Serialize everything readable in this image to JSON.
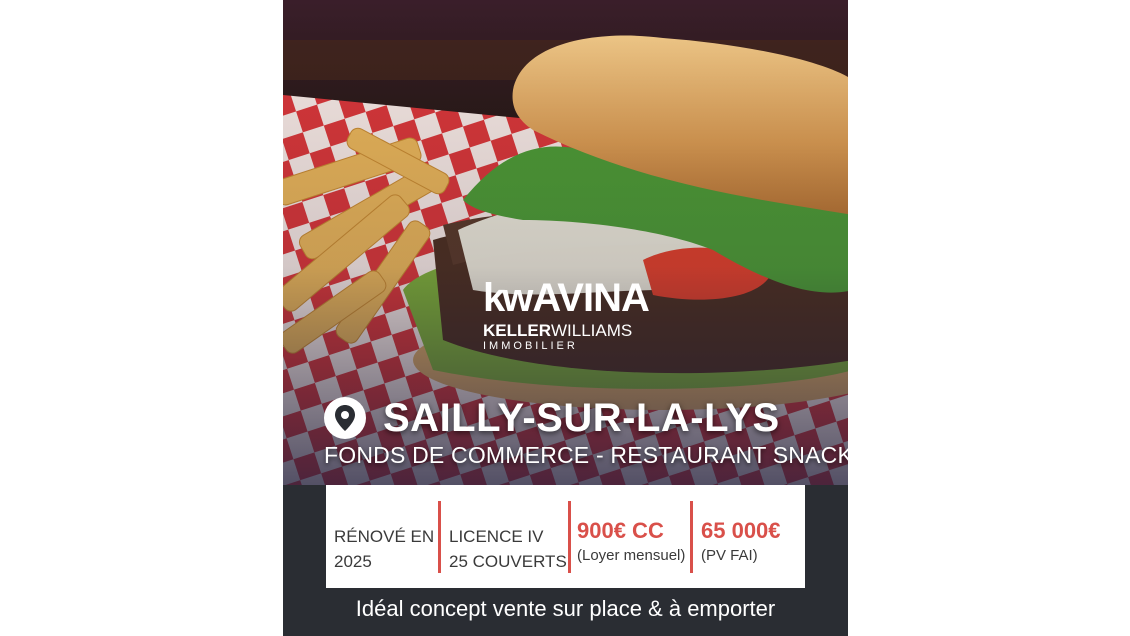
{
  "logo": {
    "kw": "kw",
    "brand": "AVINA",
    "sub_bold": "KELLER",
    "sub_thin": "WILLIAMS",
    "tagline": "IMMOBILIER"
  },
  "location": {
    "icon": "location-pin-icon",
    "city": "SAILLY-SUR-LA-LYS"
  },
  "subtitle": "FONDS DE COMMERCE - RESTAURANT SNACK",
  "features": [
    {
      "line1": "RÉNOVÉ EN",
      "line2": "2025"
    },
    {
      "line1": "LICENCE IV",
      "line2": "25 COUVERTS"
    },
    {
      "price": "900€ CC",
      "note": "(Loyer mensuel)"
    },
    {
      "price": "65 000€",
      "note": "(PV FAI)"
    }
  ],
  "footer": "Idéal concept vente sur place & à emporter",
  "colors": {
    "accent": "#d9504a",
    "footer_bg": "#2a2d33",
    "box_bg": "#ffffff"
  }
}
